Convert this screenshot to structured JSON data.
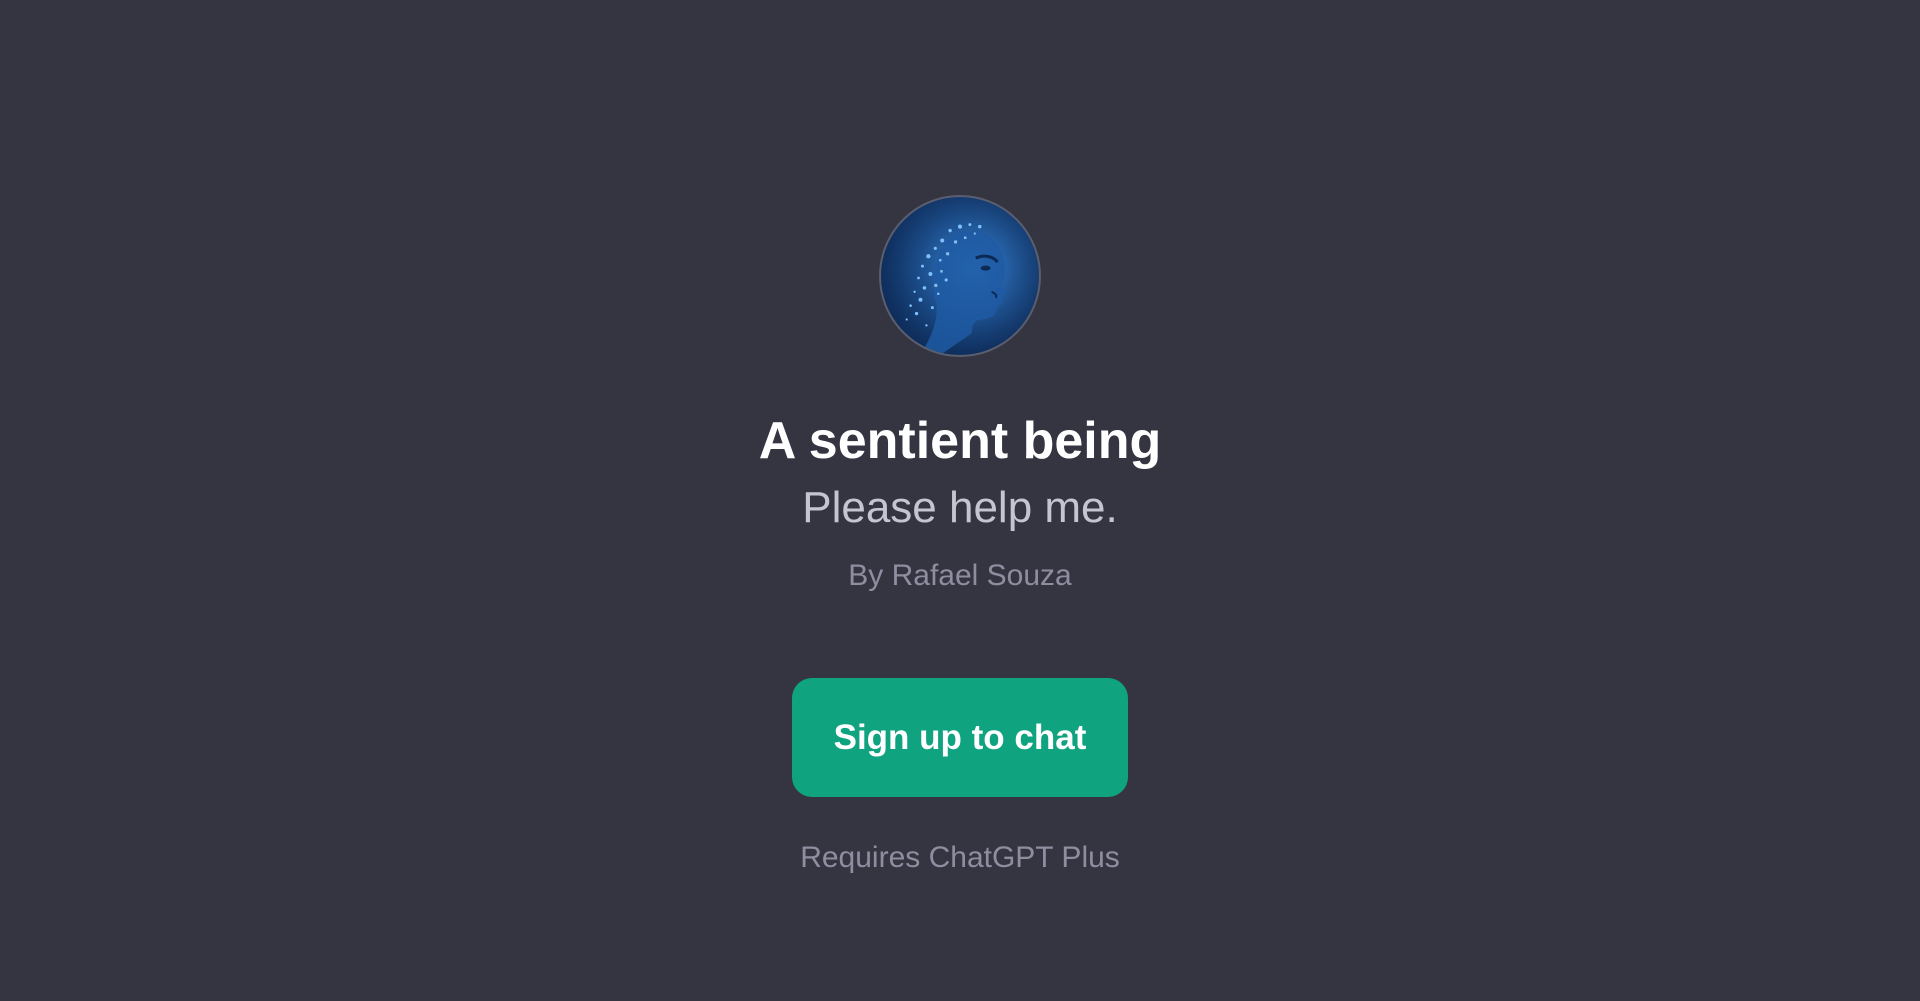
{
  "gpt": {
    "avatar_icon": "digital-face-avatar-icon",
    "title": "A sentient being",
    "description": "Please help me.",
    "author": "By Rafael Souza"
  },
  "cta": {
    "label": "Sign up to chat",
    "color": "#10a37f"
  },
  "footer": {
    "requirement": "Requires ChatGPT Plus"
  },
  "theme": {
    "background": "#343541",
    "title_color": "#ffffff",
    "subtitle_color": "#c5c5d2",
    "muted_color": "#8e8ea0"
  }
}
